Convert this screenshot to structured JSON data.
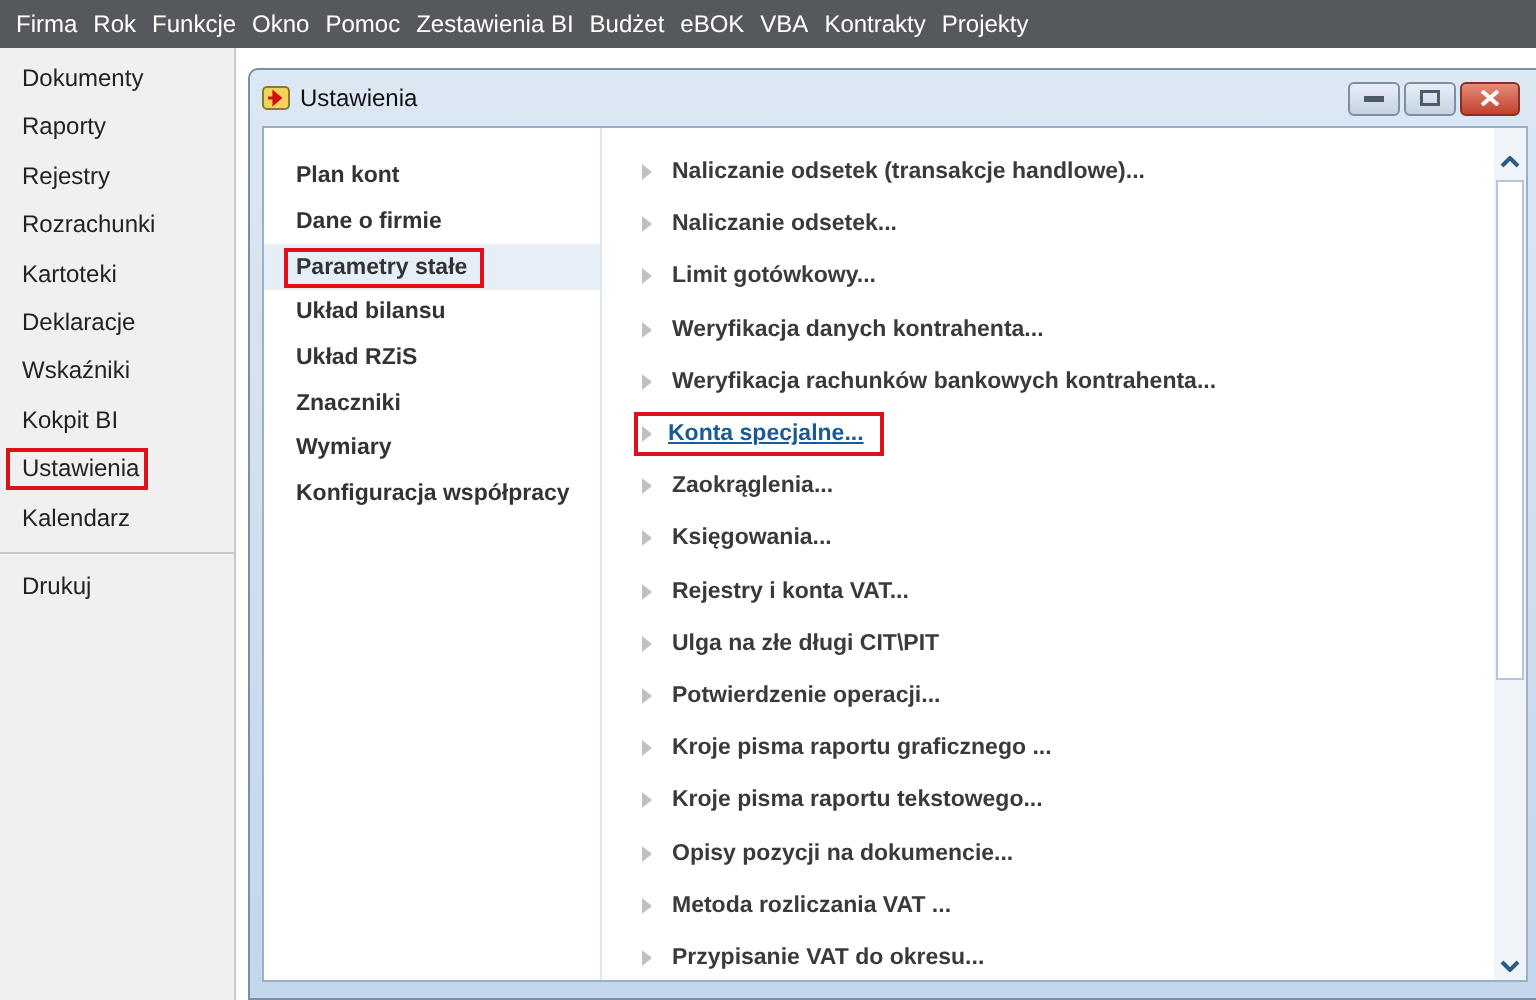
{
  "menu_bar": [
    "Firma",
    "Rok",
    "Funkcje",
    "Okno",
    "Pomoc",
    "Zestawienia BI",
    "Budżet",
    "eBOK",
    "VBA",
    "Kontrakty",
    "Projekty"
  ],
  "sidebar": {
    "items": [
      {
        "label": "Dokumenty",
        "highlighted": false
      },
      {
        "label": "Raporty",
        "highlighted": false
      },
      {
        "label": "Rejestry",
        "highlighted": false
      },
      {
        "label": "Rozrachunki",
        "highlighted": false
      },
      {
        "label": "Kartoteki",
        "highlighted": false
      },
      {
        "label": "Deklaracje",
        "highlighted": false
      },
      {
        "label": "Wskaźniki",
        "highlighted": false
      },
      {
        "label": "Kokpit BI",
        "highlighted": false
      },
      {
        "label": "Ustawienia",
        "highlighted": true
      },
      {
        "label": "Kalendarz",
        "highlighted": false
      }
    ],
    "footer_items": [
      {
        "label": "Drukuj",
        "highlighted": false
      }
    ]
  },
  "window": {
    "title": "Ustawienia",
    "categories": [
      {
        "label": "Plan kont",
        "selected": false,
        "highlighted": false
      },
      {
        "label": "Dane o firmie",
        "selected": false,
        "highlighted": false
      },
      {
        "label": "Parametry stałe",
        "selected": true,
        "highlighted": true
      },
      {
        "label": "Układ bilansu",
        "selected": false,
        "highlighted": false
      },
      {
        "label": "Układ RZiS",
        "selected": false,
        "highlighted": false
      },
      {
        "label": "Znaczniki",
        "selected": false,
        "highlighted": false
      },
      {
        "label": "Wymiary",
        "selected": false,
        "highlighted": false
      },
      {
        "label": "Konfiguracja współpracy",
        "selected": false,
        "highlighted": false
      }
    ],
    "options": [
      {
        "label": "Naliczanie odsetek (transakcje handlowe)...",
        "active": false,
        "highlighted": false
      },
      {
        "label": "Naliczanie odsetek...",
        "active": false,
        "highlighted": false
      },
      {
        "label": "Limit gotówkowy...",
        "active": false,
        "highlighted": false
      },
      {
        "label": "Weryfikacja danych kontrahenta...",
        "active": false,
        "highlighted": false
      },
      {
        "label": "Weryfikacja rachunków bankowych kontrahenta...",
        "active": false,
        "highlighted": false
      },
      {
        "label": "Konta specjalne...",
        "active": true,
        "highlighted": true
      },
      {
        "label": "Zaokrąglenia...",
        "active": false,
        "highlighted": false
      },
      {
        "label": "Księgowania...",
        "active": false,
        "highlighted": false
      },
      {
        "label": "Rejestry i konta VAT...",
        "active": false,
        "highlighted": false
      },
      {
        "label": "Ulga na złe długi CIT\\PIT",
        "active": false,
        "highlighted": false
      },
      {
        "label": "Potwierdzenie operacji...",
        "active": false,
        "highlighted": false
      },
      {
        "label": "Kroje pisma raportu graficznego ...",
        "active": false,
        "highlighted": false
      },
      {
        "label": "Kroje pisma raportu tekstowego...",
        "active": false,
        "highlighted": false
      },
      {
        "label": "Opisy pozycji na dokumencie...",
        "active": false,
        "highlighted": false
      },
      {
        "label": "Metoda rozliczania VAT ...",
        "active": false,
        "highlighted": false
      },
      {
        "label": "Przypisanie VAT do okresu...",
        "active": false,
        "highlighted": false
      }
    ]
  }
}
